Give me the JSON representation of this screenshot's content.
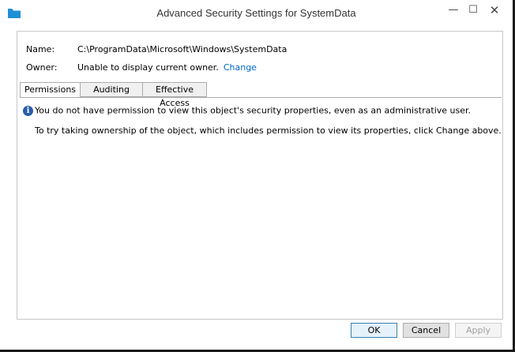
{
  "window": {
    "title": "Advanced Security Settings for SystemData",
    "controls": {
      "minimize": "—",
      "maximize": "☐",
      "close": "✕"
    },
    "icon": "folder-icon"
  },
  "details": {
    "name_label": "Name:",
    "name_value": "C:\\ProgramData\\Microsoft\\Windows\\SystemData",
    "owner_label": "Owner:",
    "owner_value": "Unable to display current owner.",
    "owner_change_link": "Change"
  },
  "tabs": [
    {
      "label": "Permissions",
      "active": true
    },
    {
      "label": "Auditing",
      "active": false
    },
    {
      "label": "Effective Access",
      "active": false
    }
  ],
  "message": {
    "icon": "info-icon",
    "info_text": "You do not have permission to view this object's security properties, even as an administrative user.",
    "hint_text": "To try taking ownership of the object, which includes permission to view its properties, click Change above."
  },
  "buttons": {
    "ok": "OK",
    "cancel": "Cancel",
    "apply": "Apply"
  },
  "colors": {
    "link": "#0066cc",
    "info_icon": "#2a5caa"
  }
}
